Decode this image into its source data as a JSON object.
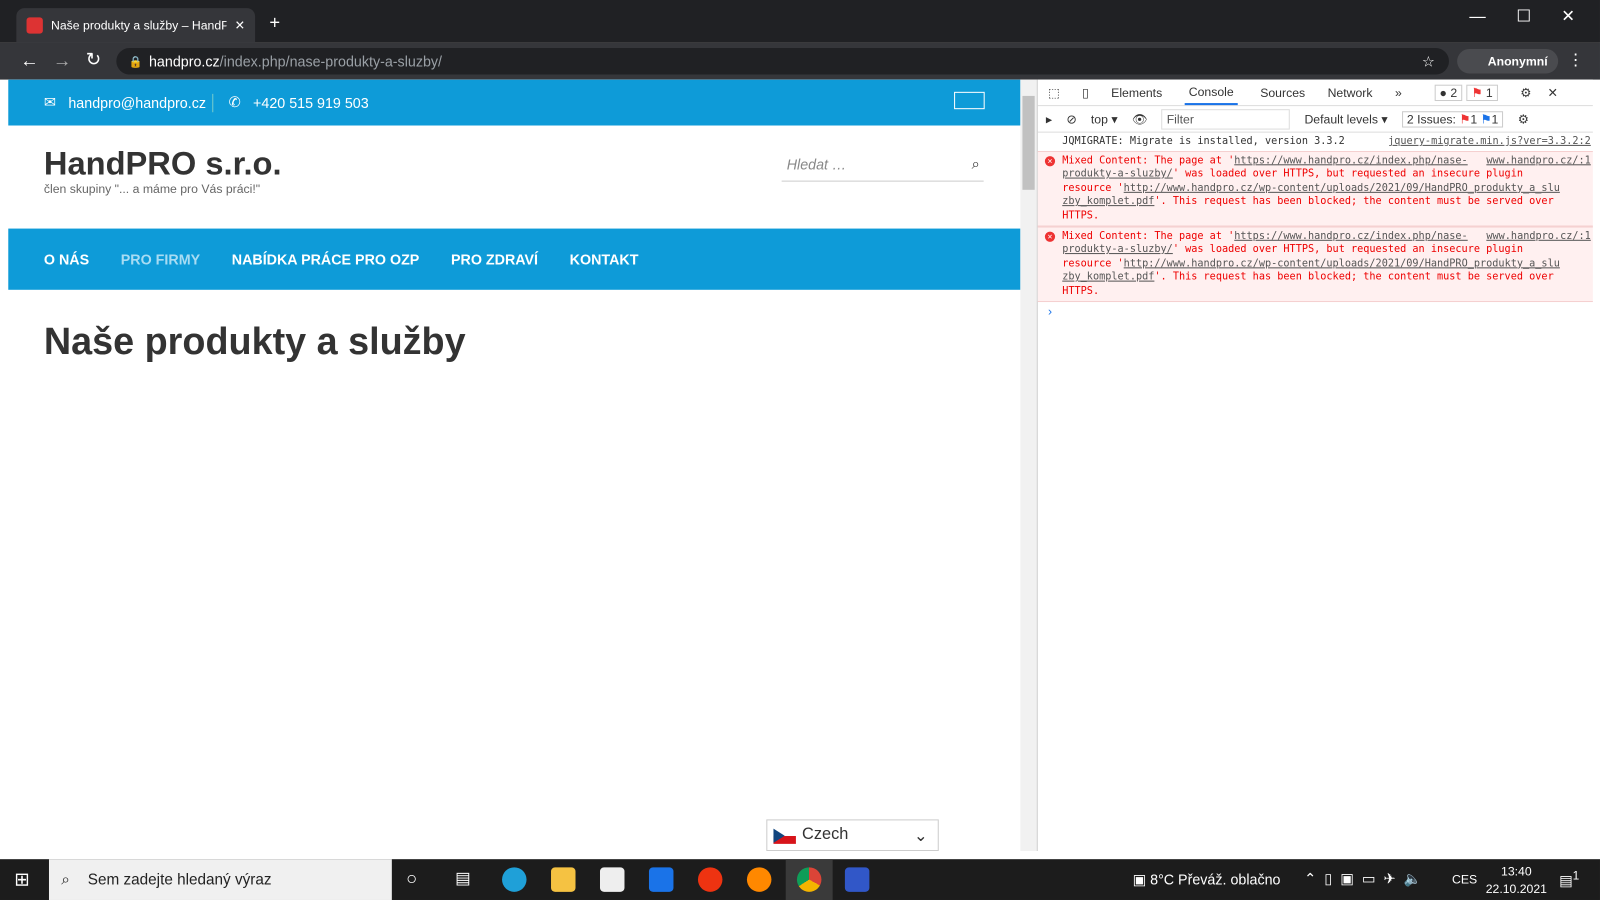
{
  "browser": {
    "tab_title": "Naše produkty a služby – HandPR",
    "url_host": "handpro.cz",
    "url_path": "/index.php/nase-produkty-a-sluzby/",
    "profile": "Anonymní"
  },
  "site": {
    "email": "handpro@handpro.cz",
    "phone": "+420 515 919 503",
    "title": "HandPRO s.r.o.",
    "tagline": "člen skupiny \"... a máme pro Vás práci!\"",
    "search_placeholder": "Hledat …",
    "nav": [
      "O NÁS",
      "PRO FIRMY",
      "NABÍDKA PRÁCE PRO OZP",
      "PRO ZDRAVÍ",
      "KONTAKT"
    ],
    "heading": "Naše produkty a služby",
    "language": "Czech"
  },
  "devtools": {
    "tabs": [
      "Elements",
      "Console",
      "Sources",
      "Network"
    ],
    "active_tab": "Console",
    "error_count": "2",
    "issue_count": "1",
    "context": "top",
    "filter_placeholder": "Filter",
    "levels": "Default levels",
    "issues_label": "2 Issues:",
    "issues_err": "1",
    "issues_info": "1",
    "messages": [
      {
        "text": "JQMIGRATE: Migrate is installed, version 3.3.2",
        "source": "jquery-migrate.min.js?ver=3.3.2:2"
      },
      {
        "pre": "Mixed Content: The page at '",
        "link1": "https://www.handpro.cz/index.php/nase-produkty-a-sluzby/",
        "source": "www.handpro.cz/:1",
        "mid": "' was loaded over HTTPS, but requested an insecure plugin resource '",
        "link2": "http://www.handpro.cz/wp-content/uploads/2021/09/HandPRO_produkty_a_sluzby_komplet.pdf",
        "post": "'. This request has been blocked; the content must be served over HTTPS."
      },
      {
        "pre": "Mixed Content: The page at '",
        "link1": "https://www.handpro.cz/index.php/nase-produkty-a-sluzby/",
        "source": "www.handpro.cz/:1",
        "mid": "' was loaded over HTTPS, but requested an insecure plugin resource '",
        "link2": "http://www.handpro.cz/wp-content/uploads/2021/09/HandPRO_produkty_a_sluzby_komplet.pdf",
        "post": "'. This request has been blocked; the content must be served over HTTPS."
      }
    ]
  },
  "taskbar": {
    "search_placeholder": "Sem zadejte hledaný výraz",
    "weather": "8°C  Převáž. oblačno",
    "lang": "CES",
    "time": "13:40",
    "date": "22.10.2021",
    "notif": "1"
  }
}
